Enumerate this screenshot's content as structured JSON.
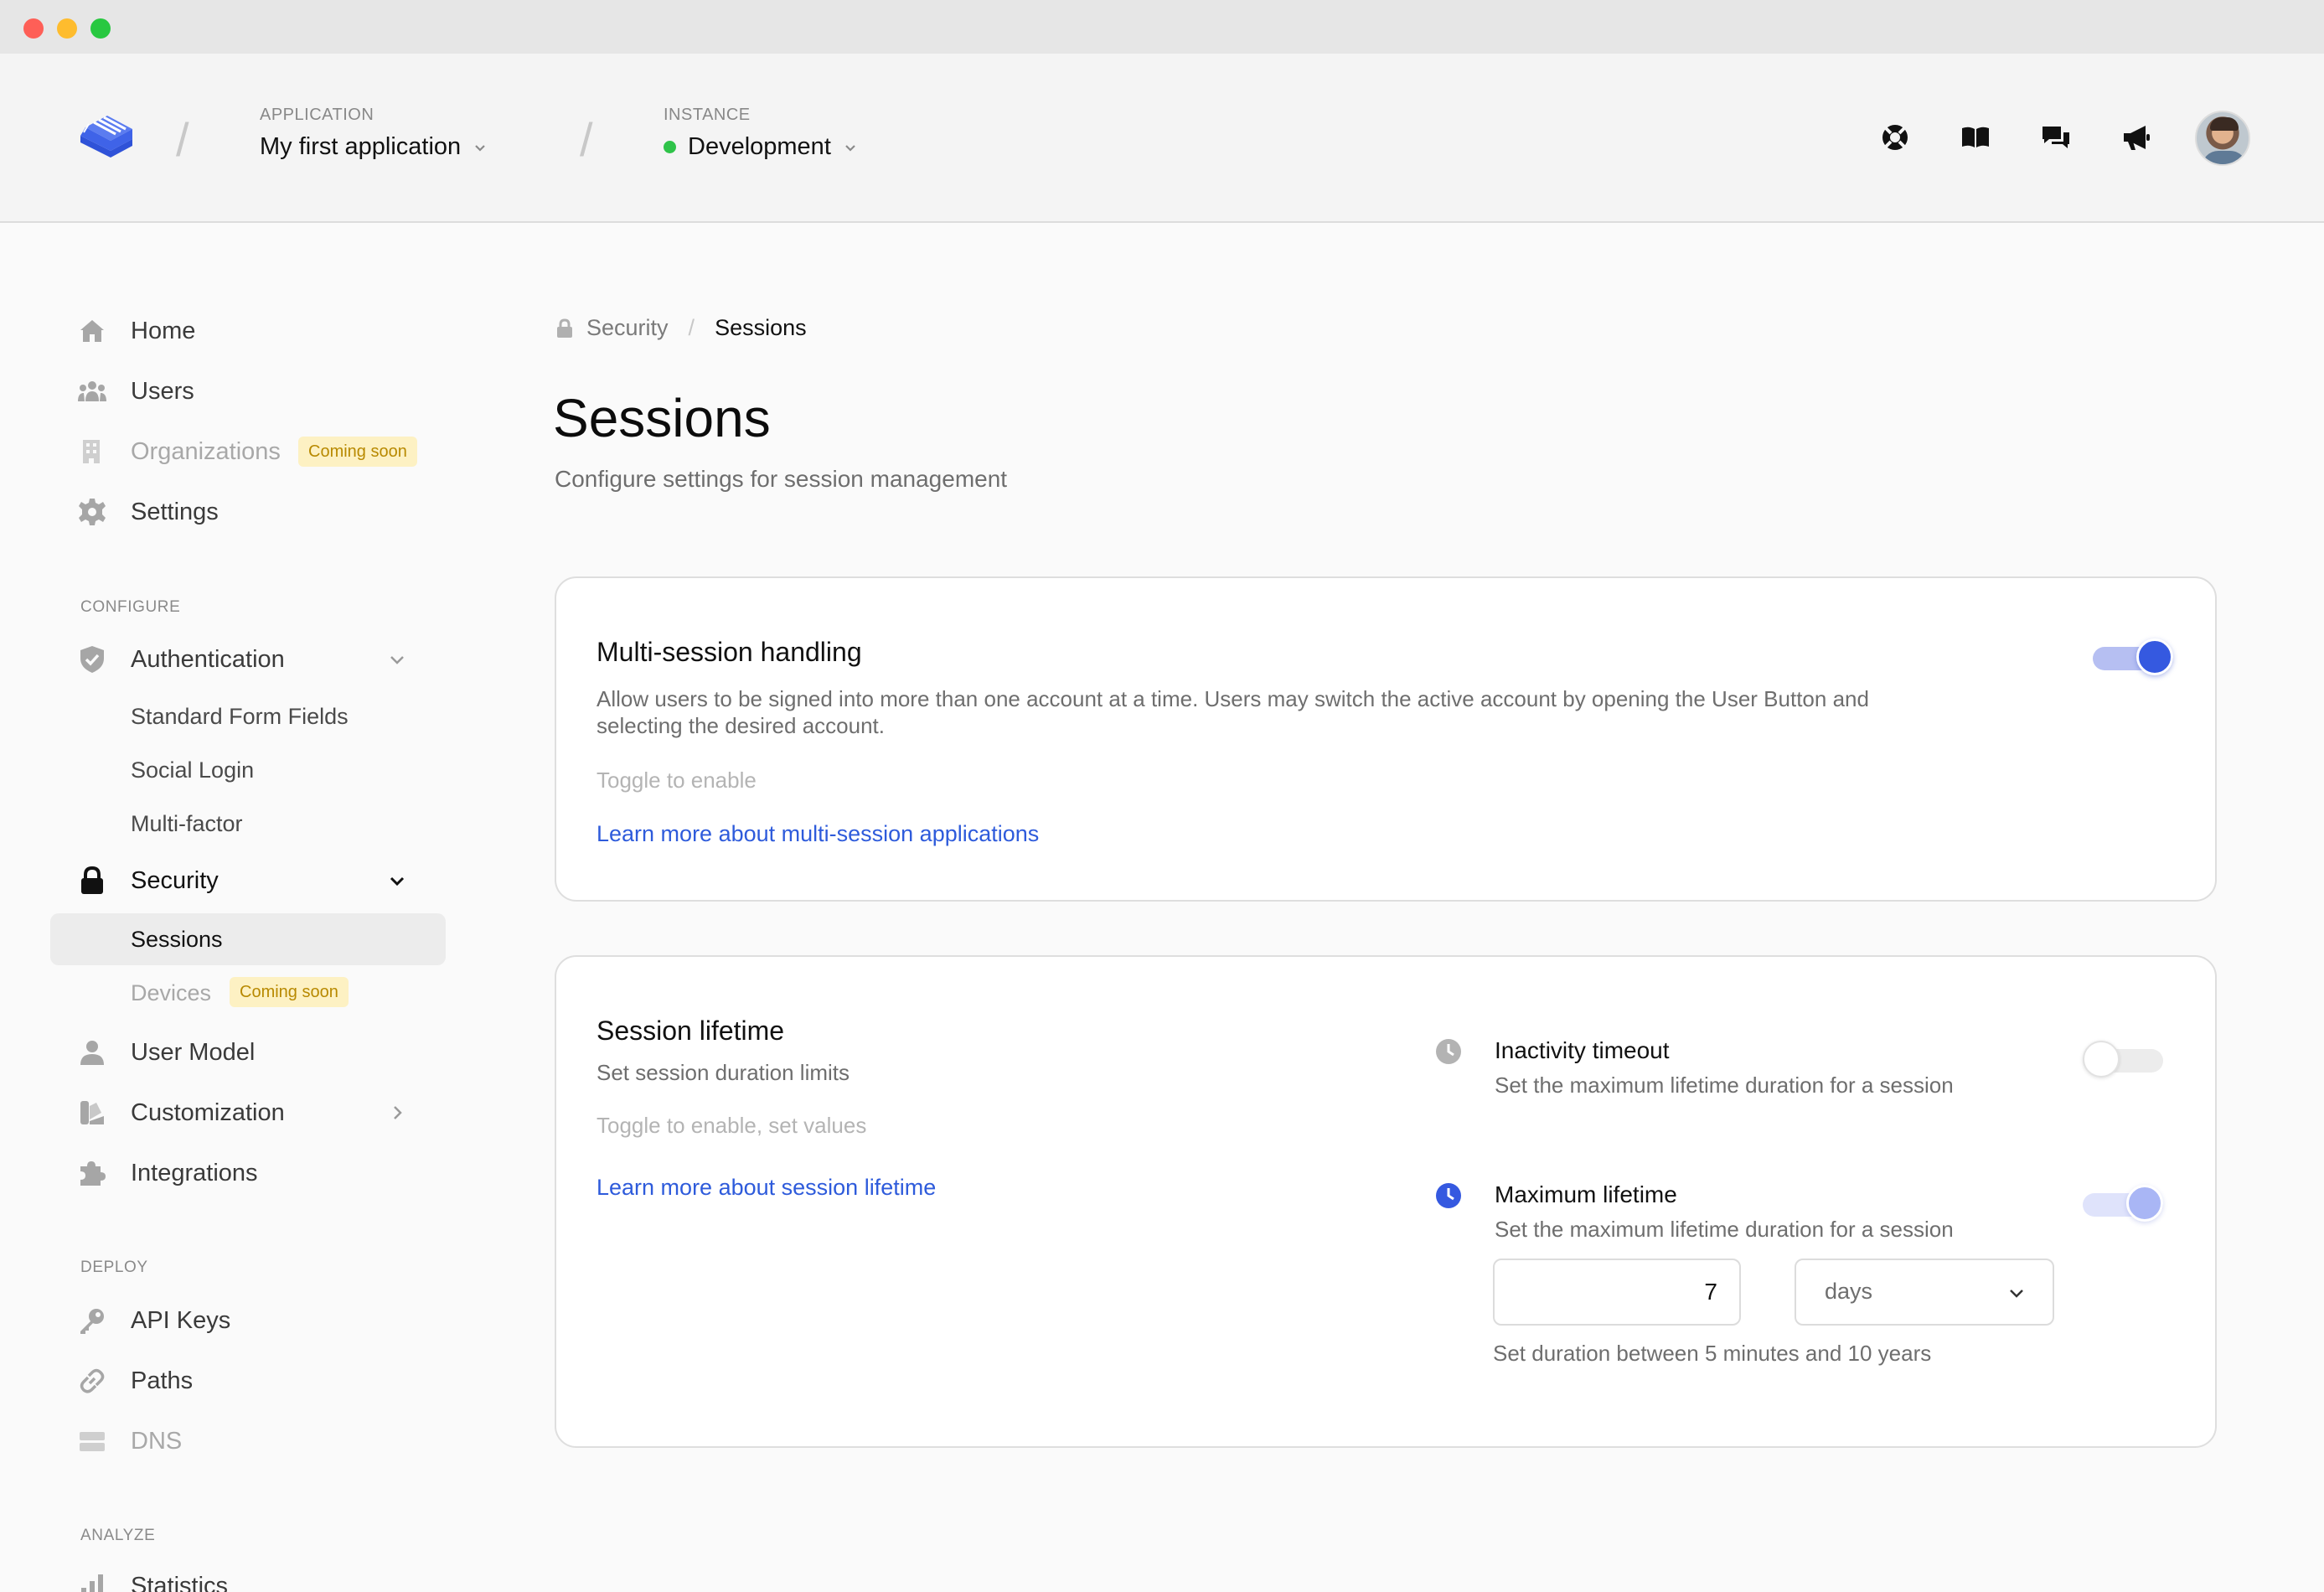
{
  "header": {
    "application": {
      "caption": "APPLICATION",
      "value": "My first application"
    },
    "instance": {
      "caption": "INSTANCE",
      "value": "Development",
      "status_color": "#2fc349"
    },
    "icons": [
      "support-icon",
      "docs-book-icon",
      "chat-icon",
      "announcements-megaphone-icon"
    ]
  },
  "sidebar": {
    "home": "Home",
    "users": "Users",
    "organizations": "Organizations",
    "organizations_badge": "Coming soon",
    "settings": "Settings",
    "configure_caption": "CONFIGURE",
    "authentication": "Authentication",
    "auth_sub": {
      "standard_form_fields": "Standard Form Fields",
      "social_login": "Social Login",
      "multi_factor": "Multi-factor"
    },
    "security": "Security",
    "security_sub": {
      "sessions": "Sessions",
      "devices": "Devices",
      "devices_badge": "Coming soon"
    },
    "user_model": "User Model",
    "customization": "Customization",
    "integrations": "Integrations",
    "deploy_caption": "DEPLOY",
    "api_keys": "API Keys",
    "paths": "Paths",
    "dns": "DNS",
    "analyze_caption": "ANALYZE",
    "statistics": "Statistics"
  },
  "breadcrumb": {
    "parent": "Security",
    "current": "Sessions"
  },
  "page": {
    "title": "Sessions",
    "subtitle": "Configure settings for session management"
  },
  "multi_session": {
    "title": "Multi-session handling",
    "description_line1": "Allow users to be signed into more than one account at a time. Users may switch the active account by opening the User Button and",
    "description_line2": "selecting the desired account.",
    "hint": "Toggle to enable",
    "link": "Learn more about multi-session applications",
    "enabled": true
  },
  "session_lifetime": {
    "title": "Session lifetime",
    "subtitle": "Set session duration limits",
    "hint": "Toggle to enable, set values",
    "link": "Learn more about session lifetime",
    "inactivity": {
      "title": "Inactivity timeout",
      "description": "Set the maximum lifetime duration for a session",
      "enabled": false
    },
    "maximum": {
      "title": "Maximum lifetime",
      "description": "Set the maximum lifetime duration for a session",
      "enabled": true,
      "value": "7",
      "unit": "days",
      "range_hint": "Set duration between 5 minutes and 10 years"
    }
  },
  "colors": {
    "accent": "#3559e0",
    "link": "#2e5bdb",
    "badge_bg": "#fdf1c3",
    "badge_text": "#b88900"
  }
}
